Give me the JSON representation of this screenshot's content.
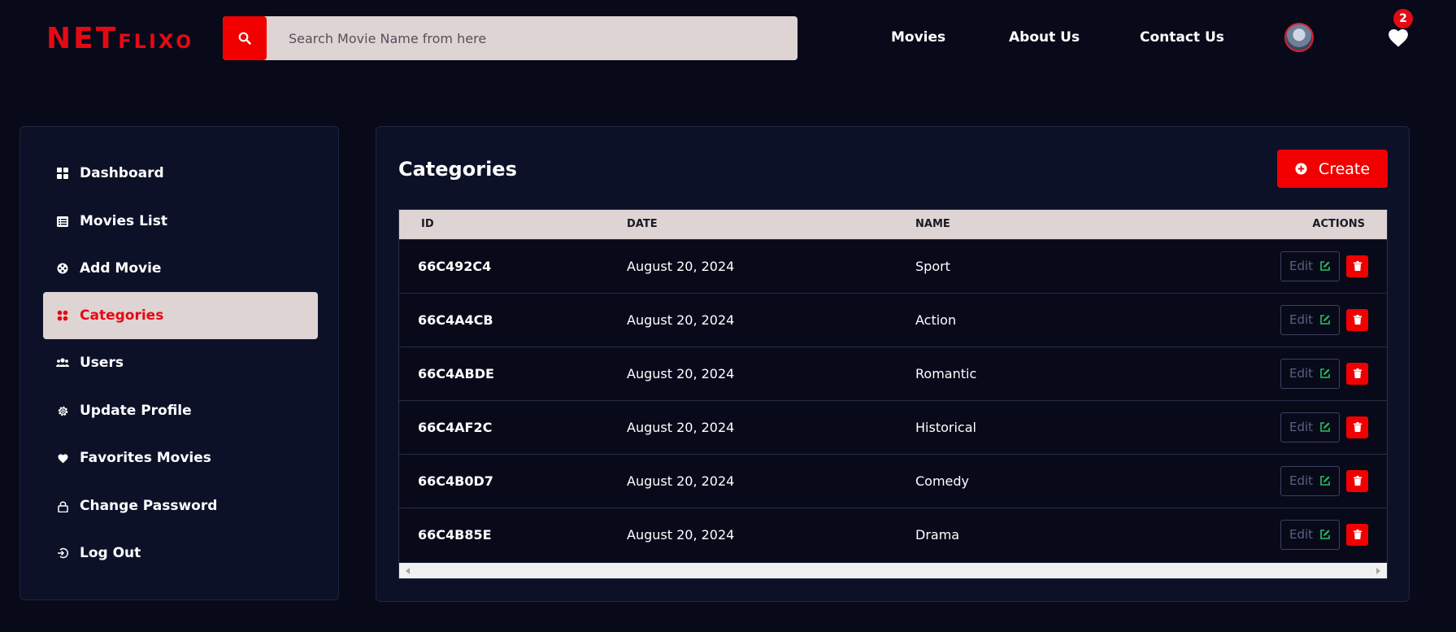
{
  "header": {
    "logo_big": "NET",
    "logo_small": "FLIX",
    "logo_end": "O",
    "search_placeholder": "Search Movie Name from here",
    "nav": [
      "Movies",
      "About Us",
      "Contact Us"
    ],
    "favorites_count": "2"
  },
  "sidebar": {
    "items": [
      {
        "label": "Dashboard",
        "icon": "dashboard-icon"
      },
      {
        "label": "Movies List",
        "icon": "list-icon"
      },
      {
        "label": "Add Movie",
        "icon": "film-reel-icon"
      },
      {
        "label": "Categories",
        "icon": "categories-icon",
        "active": true
      },
      {
        "label": "Users",
        "icon": "users-icon"
      },
      {
        "label": "Update Profile",
        "icon": "gear-icon"
      },
      {
        "label": "Favorites Movies",
        "icon": "heart-icon"
      },
      {
        "label": "Change Password",
        "icon": "lock-icon"
      },
      {
        "label": "Log Out",
        "icon": "logout-icon"
      }
    ]
  },
  "main": {
    "title": "Categories",
    "create_label": "Create",
    "columns": [
      "ID",
      "DATE",
      "NAME",
      "ACTIONS"
    ],
    "edit_label": "Edit",
    "rows": [
      {
        "id": "66C492C4",
        "date": "August 20, 2024",
        "name": "Sport"
      },
      {
        "id": "66C4A4CB",
        "date": "August 20, 2024",
        "name": "Action"
      },
      {
        "id": "66C4ABDE",
        "date": "August 20, 2024",
        "name": "Romantic"
      },
      {
        "id": "66C4AF2C",
        "date": "August 20, 2024",
        "name": "Historical"
      },
      {
        "id": "66C4B0D7",
        "date": "August 20, 2024",
        "name": "Comedy"
      },
      {
        "id": "66C4B85E",
        "date": "August 20, 2024",
        "name": "Drama"
      }
    ]
  },
  "colors": {
    "accent": "#e50914",
    "button_red": "#f20000",
    "background": "#080a1a",
    "panel": "#0c1128",
    "highlight": "#ded4d4"
  }
}
